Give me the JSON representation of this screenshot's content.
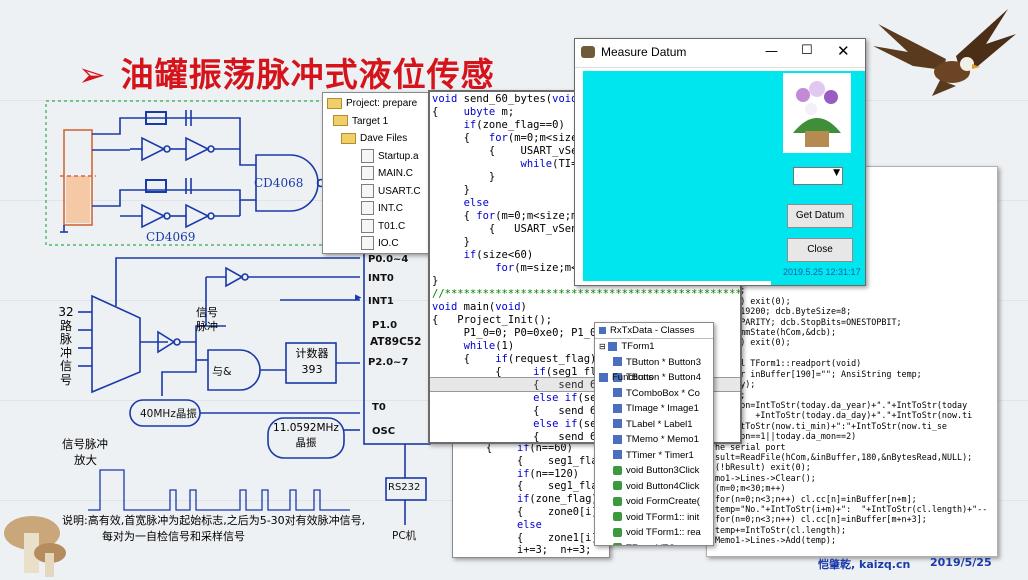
{
  "slide": {
    "title": "油罐振荡脉冲式液位传感",
    "author": "恺肇乾, kaizq.cn",
    "date": "2019/5/25"
  },
  "circuit": {
    "cd4068": "CD4068",
    "cd4069": "CD4069",
    "p00_4": "P0.0~4",
    "int0": "INT0",
    "int1": "INT1",
    "p10": "P1.0",
    "chip": "AT89C52",
    "p20_7": "P2.0~7",
    "t0": "T0",
    "osc": "OSC",
    "channels_32": [
      "32",
      "路",
      "脉",
      "冲",
      "信",
      "号"
    ],
    "signal_pulse": [
      "信号",
      "脉冲"
    ],
    "and_gate": "与&",
    "counter": [
      "计数器",
      "393"
    ],
    "crystal_40": "40MHz晶振",
    "crystal_11": [
      "11.0592MHz",
      "晶振"
    ],
    "rs232": "RS232",
    "pc": "PC机",
    "amp": [
      "信号脉冲",
      "放大"
    ],
    "note": [
      "说明:高有效,首宽脉冲为起始标志,之后为5-30对有效脉冲信号,",
      "每对为一自检信号和采样信号"
    ]
  },
  "project_tree": {
    "title": "Project: prepare",
    "target": "Target 1",
    "folder": "Dave Files",
    "files": [
      "Startup.a",
      "MAIN.C",
      "USART.C",
      "INT.C",
      "T01.C",
      "IO.C"
    ]
  },
  "editor": {
    "lines": [
      "void send_60_bytes(void)",
      "{    ubyte m;",
      "     if(zone_flag==0)",
      "     {   for(m=0;m<size;m++)",
      "         {    USART_vSendData(zone0[m]);",
      "              while(TI==0)  ;",
      "         }",
      "     }",
      "     else",
      "     { for(m=0;m<size;m++)",
      "         {   USART_vSendData(zone1[m]);",
      "     }",
      "     if(size<60)",
      "          for(m=size;m<60;m++)  USART_vSendData(0x00",
      "}",
      "//*****************************************************",
      "void main(void)",
      "{   Project_Init();",
      "     P1_0=0; P0=0xe0; P1_0",
      "     while(1)",
      "     {    if(request_flag)",
      "          {     if(seg1_flag",
      "                {   send 60 by",
      "                else if(seg2_",
      "                {   send 60 by",
      "                else if(seg3_",
      "                {   send 60 by"
    ],
    "lower_lines": [
      "     {    if(n==60)",
      "          {    seg1_flag=",
      "          if(n==120)",
      "          {    seg1_flag=",
      "          if(zone_flag)",
      "          {    zone0[i]",
      "          else",
      "          {    zone1[i]",
      "          i+=3;  n+=3;"
    ]
  },
  "measure_window": {
    "title": "Measure Datum",
    "get_button": "Get Datum",
    "close_button": "Close",
    "timestamp": "2019.5.25 12:31:17",
    "dropdown_value": ""
  },
  "classes_window": {
    "title": "RxTxData - Classes",
    "root": "TForm1",
    "members": [
      "TButton * Button3",
      "TButton * Button4",
      "TComboBox * Co",
      "TImage * Image1",
      "TLabel * Label1",
      "TMemo * Memo1",
      "TTimer * Timer1",
      "void Button3Click",
      "void Button4Click",
      "void FormCreate(",
      "void TForm1:: init",
      "void TForm1:: rea",
      "TForm1(TCompo",
      "void Timer1Timer"
    ],
    "functions": "Functions"
  },
  "cpp_code": {
    "lines": [
      "DM1\");",
      "DM2\");",
      "ENERIC_WRITE,0,",
      ",OPEN_EXISTING,0,NULL);",
      "t(0);",
      "",
      "ORD;",
      "=MAXDWORD;",
      "000;//65000;",
      "outs);",
      "ccess) exit(0);",
      "Rate=19200; dcb.ByteSize=8;",
      "ty=NOPARITY; dcb.StopBits=ONESTOPBIT;",
      "SetCommState(hCom,&dcb);",
      "ccess) exit(0);",
      "",
      "stcall TForm1::readport(void)",
      "  char inBuffer[190]=\"\"; AnsiString temp;",
      "&today);",
      "&now);",
      "Caption=IntToStr(today.da_year)+\".\"+IntToStr(today",
      "        +IntToStr(today.da_day)+\".\"+IntToStr(now.ti",
      "ty=IntToStr(now.ti_min)+\":\"+IntToStr(now.ti_se",
      ".da_mon==1||today.da_mon==2)",
      "he serial port",
      "sult=ReadFile(hCom,&inBuffer,180,&nBytesRead,NULL);",
      "(!bResult) exit(0);",
      "mo1->Lines->Clear();",
      "(m=0;m<30;m++)",
      "for(n=0;n<3;n++) cl.cc[n]=inBuffer[n+m];",
      "temp=\"No.\"+IntToStr(i+m)+\":  \"+IntToStr(cl.length)+\"--",
      "for(n=0;n<3;n++) cl.cc[n]=inBuffer[m+n+3];",
      "temp+=IntToStr(cl.length);",
      "Memo1->Lines->Add(temp);"
    ]
  },
  "colors": {
    "title_red": "#d4141a",
    "circuit_blue": "#1a3aa8",
    "client_cyan": "#00e6ef",
    "keyword_blue": "#0000d0",
    "comment_green": "#008000"
  }
}
